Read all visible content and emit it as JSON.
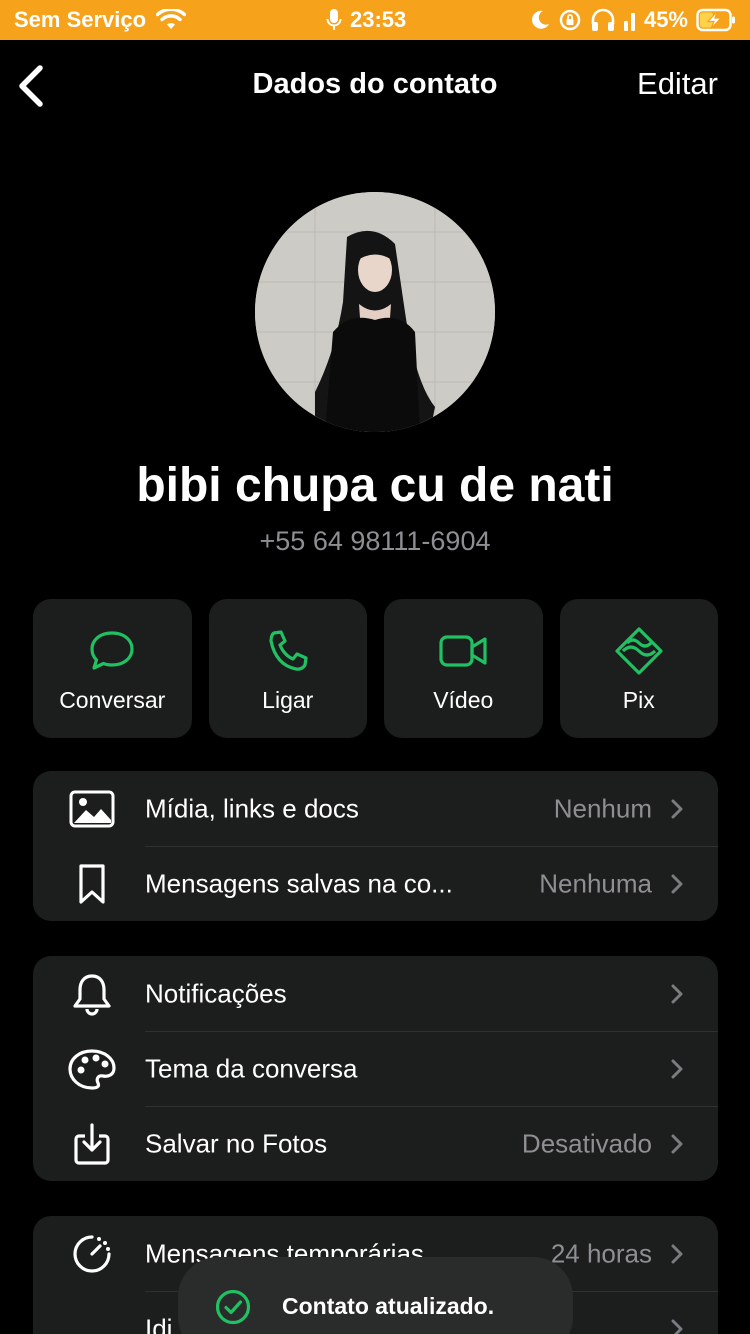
{
  "status_bar": {
    "carrier": "Sem Serviço",
    "time": "23:53",
    "battery": "45%"
  },
  "nav": {
    "title": "Dados do contato",
    "edit_label": "Editar"
  },
  "contact": {
    "name": "bibi chupa cu de nati",
    "phone": "+55 64 98111-6904"
  },
  "actions": [
    {
      "label": "Conversar",
      "icon": "chat-icon"
    },
    {
      "label": "Ligar",
      "icon": "phone-icon"
    },
    {
      "label": "Vídeo",
      "icon": "video-icon"
    },
    {
      "label": "Pix",
      "icon": "pix-icon"
    }
  ],
  "group1": [
    {
      "label": "Mídia, links e docs",
      "value": "Nenhum",
      "icon": "image-icon"
    },
    {
      "label": "Mensagens salvas na co...",
      "value": "Nenhuma",
      "icon": "bookmark-icon"
    }
  ],
  "group2": [
    {
      "label": "Notificações",
      "value": "",
      "icon": "bell-icon"
    },
    {
      "label": "Tema da conversa",
      "value": "",
      "icon": "palette-icon"
    },
    {
      "label": "Salvar no Fotos",
      "value": "Desativado",
      "icon": "save-icon"
    }
  ],
  "group3": [
    {
      "label": "Mensagens temporárias",
      "value": "24 horas",
      "icon": "timer-icon"
    },
    {
      "label": "Idi",
      "value": "",
      "icon": "language-icon"
    }
  ],
  "toast": {
    "label": "Contato atualizado."
  },
  "colors": {
    "accent": "#21c063",
    "status_bar": "#f7a21b",
    "card": "#1c1d1d",
    "secondary_text": "#8e8e93"
  }
}
